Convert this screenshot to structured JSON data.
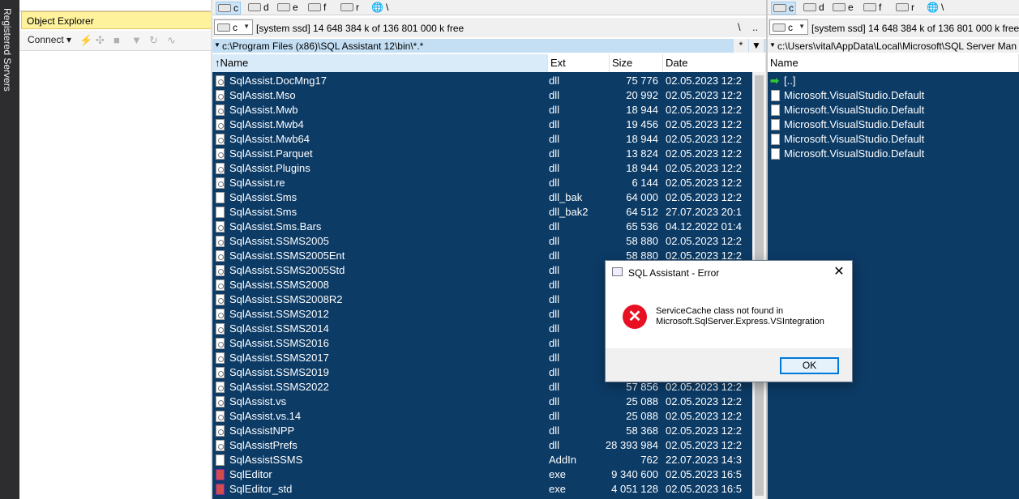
{
  "sidebar": {
    "registered_servers": "Registered Servers"
  },
  "object_explorer": {
    "title": "Object Explorer",
    "connect_label": "Connect",
    "toolbar_icons": [
      "plug-icon",
      "disconnect-icon",
      "stop-icon",
      "filter-icon",
      "refresh-icon",
      "activity-icon"
    ]
  },
  "left_panel": {
    "drives": [
      "c",
      "d",
      "e",
      "f",
      "r",
      "\\"
    ],
    "active_drive": "c",
    "drive_select": "c",
    "free_space": "[system ssd]  14 648 384 k of 136 801 000 k free",
    "nav_root": "\\",
    "nav_up": "..",
    "path": "c:\\Program Files (x86)\\SQL Assistant 12\\bin\\*.*",
    "path_btn_star": "*",
    "path_btn_down": "▼",
    "columns": {
      "name": "Name",
      "ext": "Ext",
      "size": "Size",
      "date": "Date"
    },
    "files": [
      {
        "name": "SqlAssist.DocMng17",
        "ext": "dll",
        "size": "75 776",
        "date": "02.05.2023 12:2",
        "icon": "gear"
      },
      {
        "name": "SqlAssist.Mso",
        "ext": "dll",
        "size": "20 992",
        "date": "02.05.2023 12:2",
        "icon": "gear"
      },
      {
        "name": "SqlAssist.Mwb",
        "ext": "dll",
        "size": "18 944",
        "date": "02.05.2023 12:2",
        "icon": "gear"
      },
      {
        "name": "SqlAssist.Mwb4",
        "ext": "dll",
        "size": "19 456",
        "date": "02.05.2023 12:2",
        "icon": "gear"
      },
      {
        "name": "SqlAssist.Mwb64",
        "ext": "dll",
        "size": "18 944",
        "date": "02.05.2023 12:2",
        "icon": "gear"
      },
      {
        "name": "SqlAssist.Parquet",
        "ext": "dll",
        "size": "13 824",
        "date": "02.05.2023 12:2",
        "icon": "gear"
      },
      {
        "name": "SqlAssist.Plugins",
        "ext": "dll",
        "size": "18 944",
        "date": "02.05.2023 12:2",
        "icon": "gear"
      },
      {
        "name": "SqlAssist.re",
        "ext": "dll",
        "size": "6 144",
        "date": "02.05.2023 12:2",
        "icon": "gear"
      },
      {
        "name": "SqlAssist.Sms",
        "ext": "dll_bak",
        "size": "64 000",
        "date": "02.05.2023 12:2",
        "icon": "file"
      },
      {
        "name": "SqlAssist.Sms",
        "ext": "dll_bak2",
        "size": "64 512",
        "date": "27.07.2023 20:1",
        "icon": "file"
      },
      {
        "name": "SqlAssist.Sms.Bars",
        "ext": "dll",
        "size": "65 536",
        "date": "04.12.2022 01:4",
        "icon": "gear"
      },
      {
        "name": "SqlAssist.SSMS2005",
        "ext": "dll",
        "size": "58 880",
        "date": "02.05.2023 12:2",
        "icon": "gear"
      },
      {
        "name": "SqlAssist.SSMS2005Ent",
        "ext": "dll",
        "size": "58 880",
        "date": "02.05.2023 12:2",
        "icon": "gear"
      },
      {
        "name": "SqlAssist.SSMS2005Std",
        "ext": "dll",
        "size": "",
        "date": "",
        "icon": "gear"
      },
      {
        "name": "SqlAssist.SSMS2008",
        "ext": "dll",
        "size": "",
        "date": "",
        "icon": "gear"
      },
      {
        "name": "SqlAssist.SSMS2008R2",
        "ext": "dll",
        "size": "",
        "date": "",
        "icon": "gear"
      },
      {
        "name": "SqlAssist.SSMS2012",
        "ext": "dll",
        "size": "",
        "date": "",
        "icon": "gear"
      },
      {
        "name": "SqlAssist.SSMS2014",
        "ext": "dll",
        "size": "",
        "date": "",
        "icon": "gear"
      },
      {
        "name": "SqlAssist.SSMS2016",
        "ext": "dll",
        "size": "",
        "date": "",
        "icon": "gear"
      },
      {
        "name": "SqlAssist.SSMS2017",
        "ext": "dll",
        "size": "",
        "date": "",
        "icon": "gear"
      },
      {
        "name": "SqlAssist.SSMS2019",
        "ext": "dll",
        "size": "",
        "date": "",
        "icon": "gear"
      },
      {
        "name": "SqlAssist.SSMS2022",
        "ext": "dll",
        "size": "57 856",
        "date": "02.05.2023 12:2",
        "icon": "gear"
      },
      {
        "name": "SqlAssist.vs",
        "ext": "dll",
        "size": "25 088",
        "date": "02.05.2023 12:2",
        "icon": "gear"
      },
      {
        "name": "SqlAssist.vs.14",
        "ext": "dll",
        "size": "25 088",
        "date": "02.05.2023 12:2",
        "icon": "gear"
      },
      {
        "name": "SqlAssistNPP",
        "ext": "dll",
        "size": "58 368",
        "date": "02.05.2023 12:2",
        "icon": "gear"
      },
      {
        "name": "SqlAssistPrefs",
        "ext": "dll",
        "size": "28 393 984",
        "date": "02.05.2023 12:2",
        "icon": "gear"
      },
      {
        "name": "SqlAssistSSMS",
        "ext": "AddIn",
        "size": "762",
        "date": "22.07.2023 14:3",
        "icon": "file"
      },
      {
        "name": "SqlEditor",
        "ext": "exe",
        "size": "9 340 600",
        "date": "02.05.2023 16:5",
        "icon": "exe"
      },
      {
        "name": "SqlEditor_std",
        "ext": "exe",
        "size": "4 051 128",
        "date": "02.05.2023 16:5",
        "icon": "exe"
      }
    ]
  },
  "right_panel": {
    "drives": [
      "c",
      "d",
      "e",
      "f",
      "r",
      "\\"
    ],
    "active_drive": "c",
    "drive_select": "c",
    "free_space": "[system ssd]  14 648 384 k of 136 801 000 k free",
    "path": "c:\\Users\\vital\\AppData\\Local\\Microsoft\\SQL Server Man",
    "column_name": "Name",
    "up_label": "[..]",
    "files": [
      "Microsoft.VisualStudio.Default",
      "Microsoft.VisualStudio.Default",
      "Microsoft.VisualStudio.Default",
      "Microsoft.VisualStudio.Default",
      "Microsoft.VisualStudio.Default"
    ]
  },
  "dialog": {
    "title": "SQL Assistant - Error",
    "close": "✕",
    "message_line1": "ServiceCache class not found in",
    "message_line2": "Microsoft.SqlServer.Express.VSIntegration",
    "ok_label": "OK"
  },
  "colors": {
    "selection": "#0c3b66",
    "path_highlight": "#c4dff4",
    "oe_title": "#fff29d",
    "error": "#e81123",
    "ok_border": "#0078d7"
  }
}
